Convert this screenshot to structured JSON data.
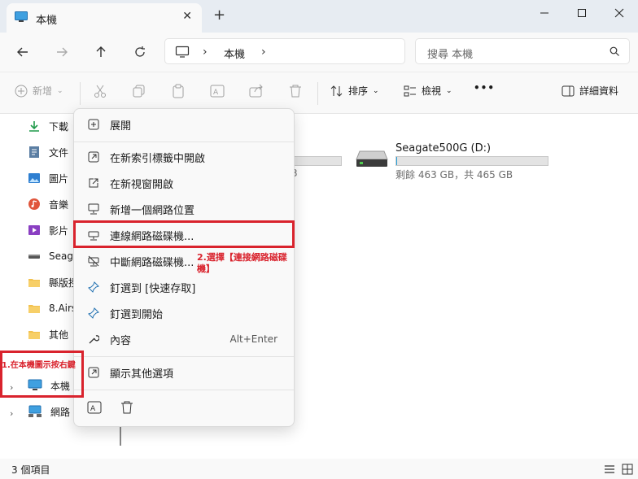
{
  "tab": {
    "title": "本機",
    "close": "✕",
    "new_tab": "+"
  },
  "window_controls": {
    "minimize": "—",
    "maximize": "☐",
    "close": "✕"
  },
  "address": {
    "location": "本機",
    "sep": "›"
  },
  "search": {
    "placeholder": "搜尋 本機"
  },
  "command_bar": {
    "new_label": "新增",
    "sort_label": "排序",
    "view_label": "檢視",
    "more_label": "•••",
    "details_label": "詳細資料"
  },
  "sidebar": {
    "items": [
      {
        "label": "下載",
        "icon": "download-icon"
      },
      {
        "label": "文件",
        "icon": "document-icon"
      },
      {
        "label": "圖片",
        "icon": "picture-icon"
      },
      {
        "label": "音樂",
        "icon": "music-icon"
      },
      {
        "label": "影片",
        "icon": "video-icon"
      },
      {
        "label": "Seagat",
        "icon": "drive-icon"
      },
      {
        "label": "縣版授",
        "icon": "folder-icon"
      },
      {
        "label": "8.Airse",
        "icon": "folder-icon"
      },
      {
        "label": "其他",
        "icon": "folder-icon"
      }
    ],
    "this_pc": "本機",
    "network": "網路"
  },
  "drives": {
    "d_name": "Seagate500G (D:)",
    "d_info": "剩餘 463 GB，共 465 GB",
    "d_used_fraction": 0.004,
    "c_info_partial": "3"
  },
  "context_menu": {
    "items": [
      {
        "label": "展開",
        "icon": "expand-icon"
      },
      {
        "label": "在新索引標籤中開啟",
        "icon": "open-tab-icon"
      },
      {
        "label": "在新視窗開啟",
        "icon": "open-window-icon"
      },
      {
        "label": "新增一個網路位置",
        "icon": "network-location-icon"
      },
      {
        "label": "連線網路磁碟機...",
        "icon": "map-drive-icon"
      },
      {
        "label": "中斷網路磁碟機...",
        "icon": "disconnect-drive-icon"
      },
      {
        "label": "釘選到 [快速存取]",
        "icon": "pin-icon"
      },
      {
        "label": "釘選到開始",
        "icon": "pin-start-icon"
      },
      {
        "label": "內容",
        "icon": "properties-icon",
        "shortcut": "Alt+Enter"
      },
      {
        "label": "顯示其他選項",
        "icon": "more-options-icon"
      }
    ]
  },
  "annotations": {
    "step1": "1.在本機圖示按右鍵",
    "step2_line1": "2.選擇【連接網路磁碟",
    "step2_line2": "機】"
  },
  "status": {
    "count": "3 個項目"
  },
  "colors": {
    "accent": "#0078d4",
    "highlight": "#d9232d",
    "drive_fill": "#26a0da"
  }
}
